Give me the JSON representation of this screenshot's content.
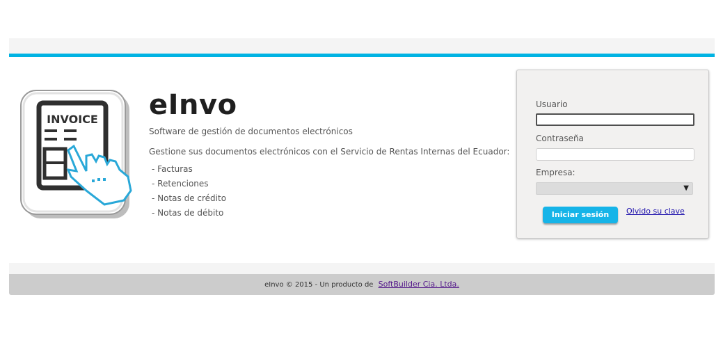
{
  "brand": {
    "title": "eInvo",
    "tagline": "Software de gestión de documentos electrónicos",
    "intro": "Gestione sus documentos electrónicos con el Servicio de Rentas Internas del Ecuador:",
    "logo_text": "INVOICE"
  },
  "features": [
    "- Facturas",
    "- Retenciones",
    "- Notas de crédito",
    "- Notas de débito"
  ],
  "login": {
    "user_label": "Usuario",
    "user_value": "",
    "password_label": "Contraseña",
    "password_value": "",
    "company_label": "Empresa:",
    "company_selected": "",
    "submit_label": "Iniciar sesión",
    "forgot_label": "Olvido su clave"
  },
  "footer": {
    "text": "eInvo © 2015 - Un producto de",
    "link_label": "SoftBuilder Cia. Ltda."
  },
  "icons": {
    "logo": "invoice-hand-icon",
    "select_arrow": "chevron-down-icon"
  },
  "colors": {
    "accent": "#00b3e3",
    "button": "#16b4e8",
    "link": "#1a0dab"
  }
}
